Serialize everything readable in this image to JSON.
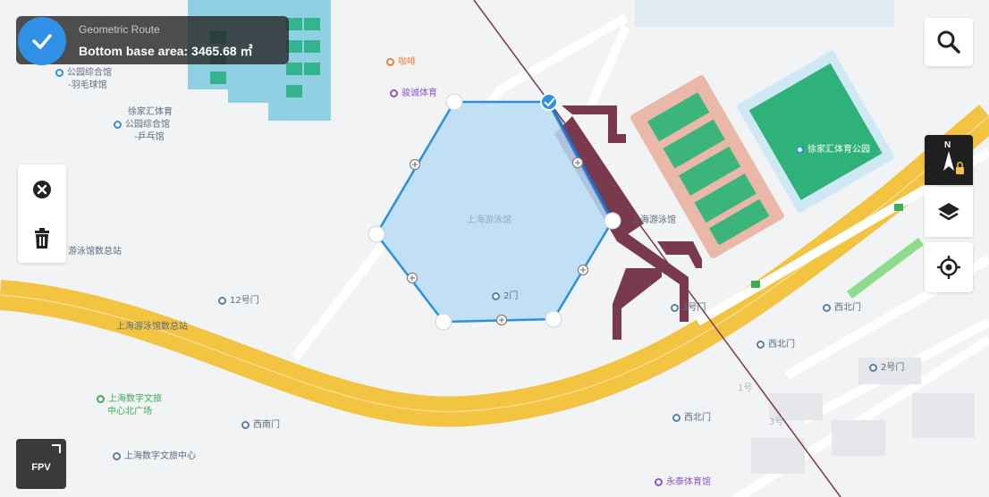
{
  "banner": {
    "subtitle": "Geometric Route",
    "area_text": "Bottom base area: 3465.68 ㎡"
  },
  "fpv_label": "FPV",
  "compass_letter": "N",
  "map_labels": [
    {
      "text": "公园综合馆",
      "pin": "blue"
    },
    {
      "text": "-羽毛球馆",
      "pin": ""
    },
    {
      "text": "徐家汇体育",
      "pin": ""
    },
    {
      "text": "公园综合馆",
      "pin": "blue"
    },
    {
      "text": "-乒乓馆",
      "pin": ""
    },
    {
      "text": "咖啡",
      "pin": "orange"
    },
    {
      "text": "骏诚体育",
      "pin": "purple"
    },
    {
      "text": "上海游泳馆",
      "pin": ""
    },
    {
      "text": "上海游泳馆",
      "pin": ""
    },
    {
      "text": "2门",
      "pin": ""
    },
    {
      "text": "3号门",
      "pin": ""
    },
    {
      "text": "12号门",
      "pin": ""
    },
    {
      "text": "上海游泳馆数总站",
      "pin": ""
    },
    {
      "text": "游泳馆数总站",
      "pin": ""
    },
    {
      "text": "徐家汇体育公园",
      "pin": ""
    },
    {
      "text": "西北门",
      "pin": ""
    },
    {
      "text": "西北门",
      "pin": ""
    },
    {
      "text": "2号门",
      "pin": ""
    },
    {
      "text": "上海数字文旅",
      "pin": "green"
    },
    {
      "text": "中心北广场",
      "pin": ""
    },
    {
      "text": "西南门",
      "pin": ""
    },
    {
      "text": "西北门",
      "pin": ""
    },
    {
      "text": "上海数字文旅中心",
      "pin": ""
    },
    {
      "text": "永泰体育馆",
      "pin": "purple"
    },
    {
      "text": "1号",
      "pin": ""
    },
    {
      "text": "3号",
      "pin": ""
    }
  ],
  "colors": {
    "accent": "#2f90e6",
    "polygon_fill": "#b9dcf6",
    "polygon_stroke": "#2d8fe0",
    "highway": "#f3c342",
    "metro": "#7a3a4d",
    "field_green": "#2fb27a",
    "court_pink": "#e9b8a8"
  },
  "icons": {
    "check": "check-icon",
    "search": "search-icon",
    "close": "close-circle-icon",
    "delete": "trash-icon",
    "compass": "compass-lock-icon",
    "layers": "layers-icon",
    "locate": "locate-icon",
    "fpv_corner": "expand-corner-icon"
  }
}
